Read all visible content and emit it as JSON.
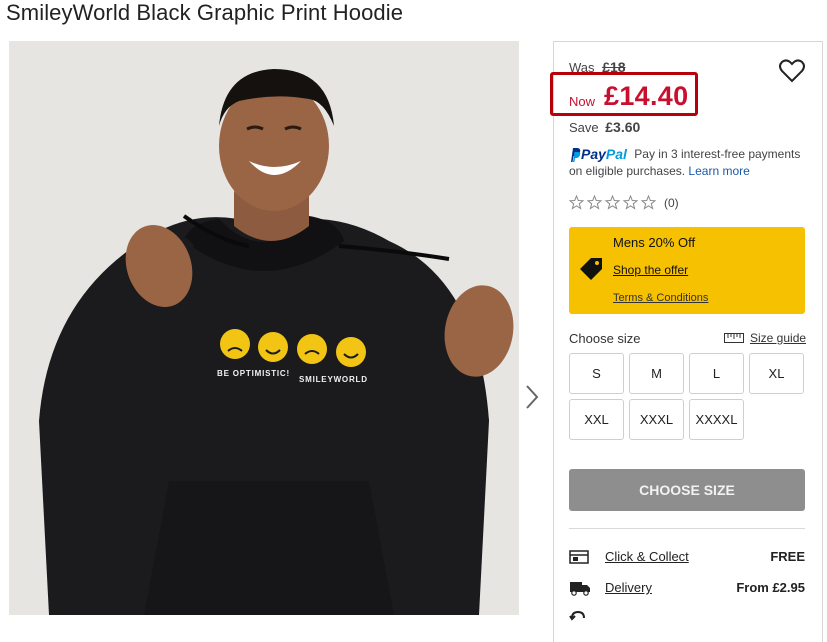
{
  "product": {
    "title": "SmileyWorld Black Graphic Print Hoodie",
    "print_slogan_left": "BE OPTIMISTIC!",
    "print_slogan_right": "SMILEYWORLD"
  },
  "price": {
    "was_label": "Was",
    "was_value": "£18",
    "now_label": "Now",
    "now_value": "£14.40",
    "save_label": "Save",
    "save_value": "£3.60"
  },
  "paypal": {
    "brand_a": "Pay",
    "brand_b": "Pal",
    "text": "Pay in 3 interest-free payments on eligible purchases.",
    "link": "Learn more"
  },
  "rating": {
    "stars_filled": 0,
    "stars_total": 5,
    "count": "(0)"
  },
  "offer": {
    "title": "Mens 20% Off",
    "link": "Shop the offer",
    "terms": "Terms & Conditions",
    "color": "#f6c100"
  },
  "size": {
    "label": "Choose size",
    "guide": "Size guide",
    "options": [
      "S",
      "M",
      "L",
      "XL",
      "XXL",
      "XXXL",
      "XXXXL"
    ]
  },
  "cta": {
    "label": "CHOOSE SIZE"
  },
  "shipping": [
    {
      "icon": "click-collect-icon",
      "label": "Click & Collect",
      "value": "FREE"
    },
    {
      "icon": "delivery-van-icon",
      "label": "Delivery",
      "value": "From £2.95"
    }
  ],
  "colors": {
    "sale_red": "#c8102e",
    "highlight_border": "#b8000b",
    "cta_grey": "#8e8e8e"
  }
}
